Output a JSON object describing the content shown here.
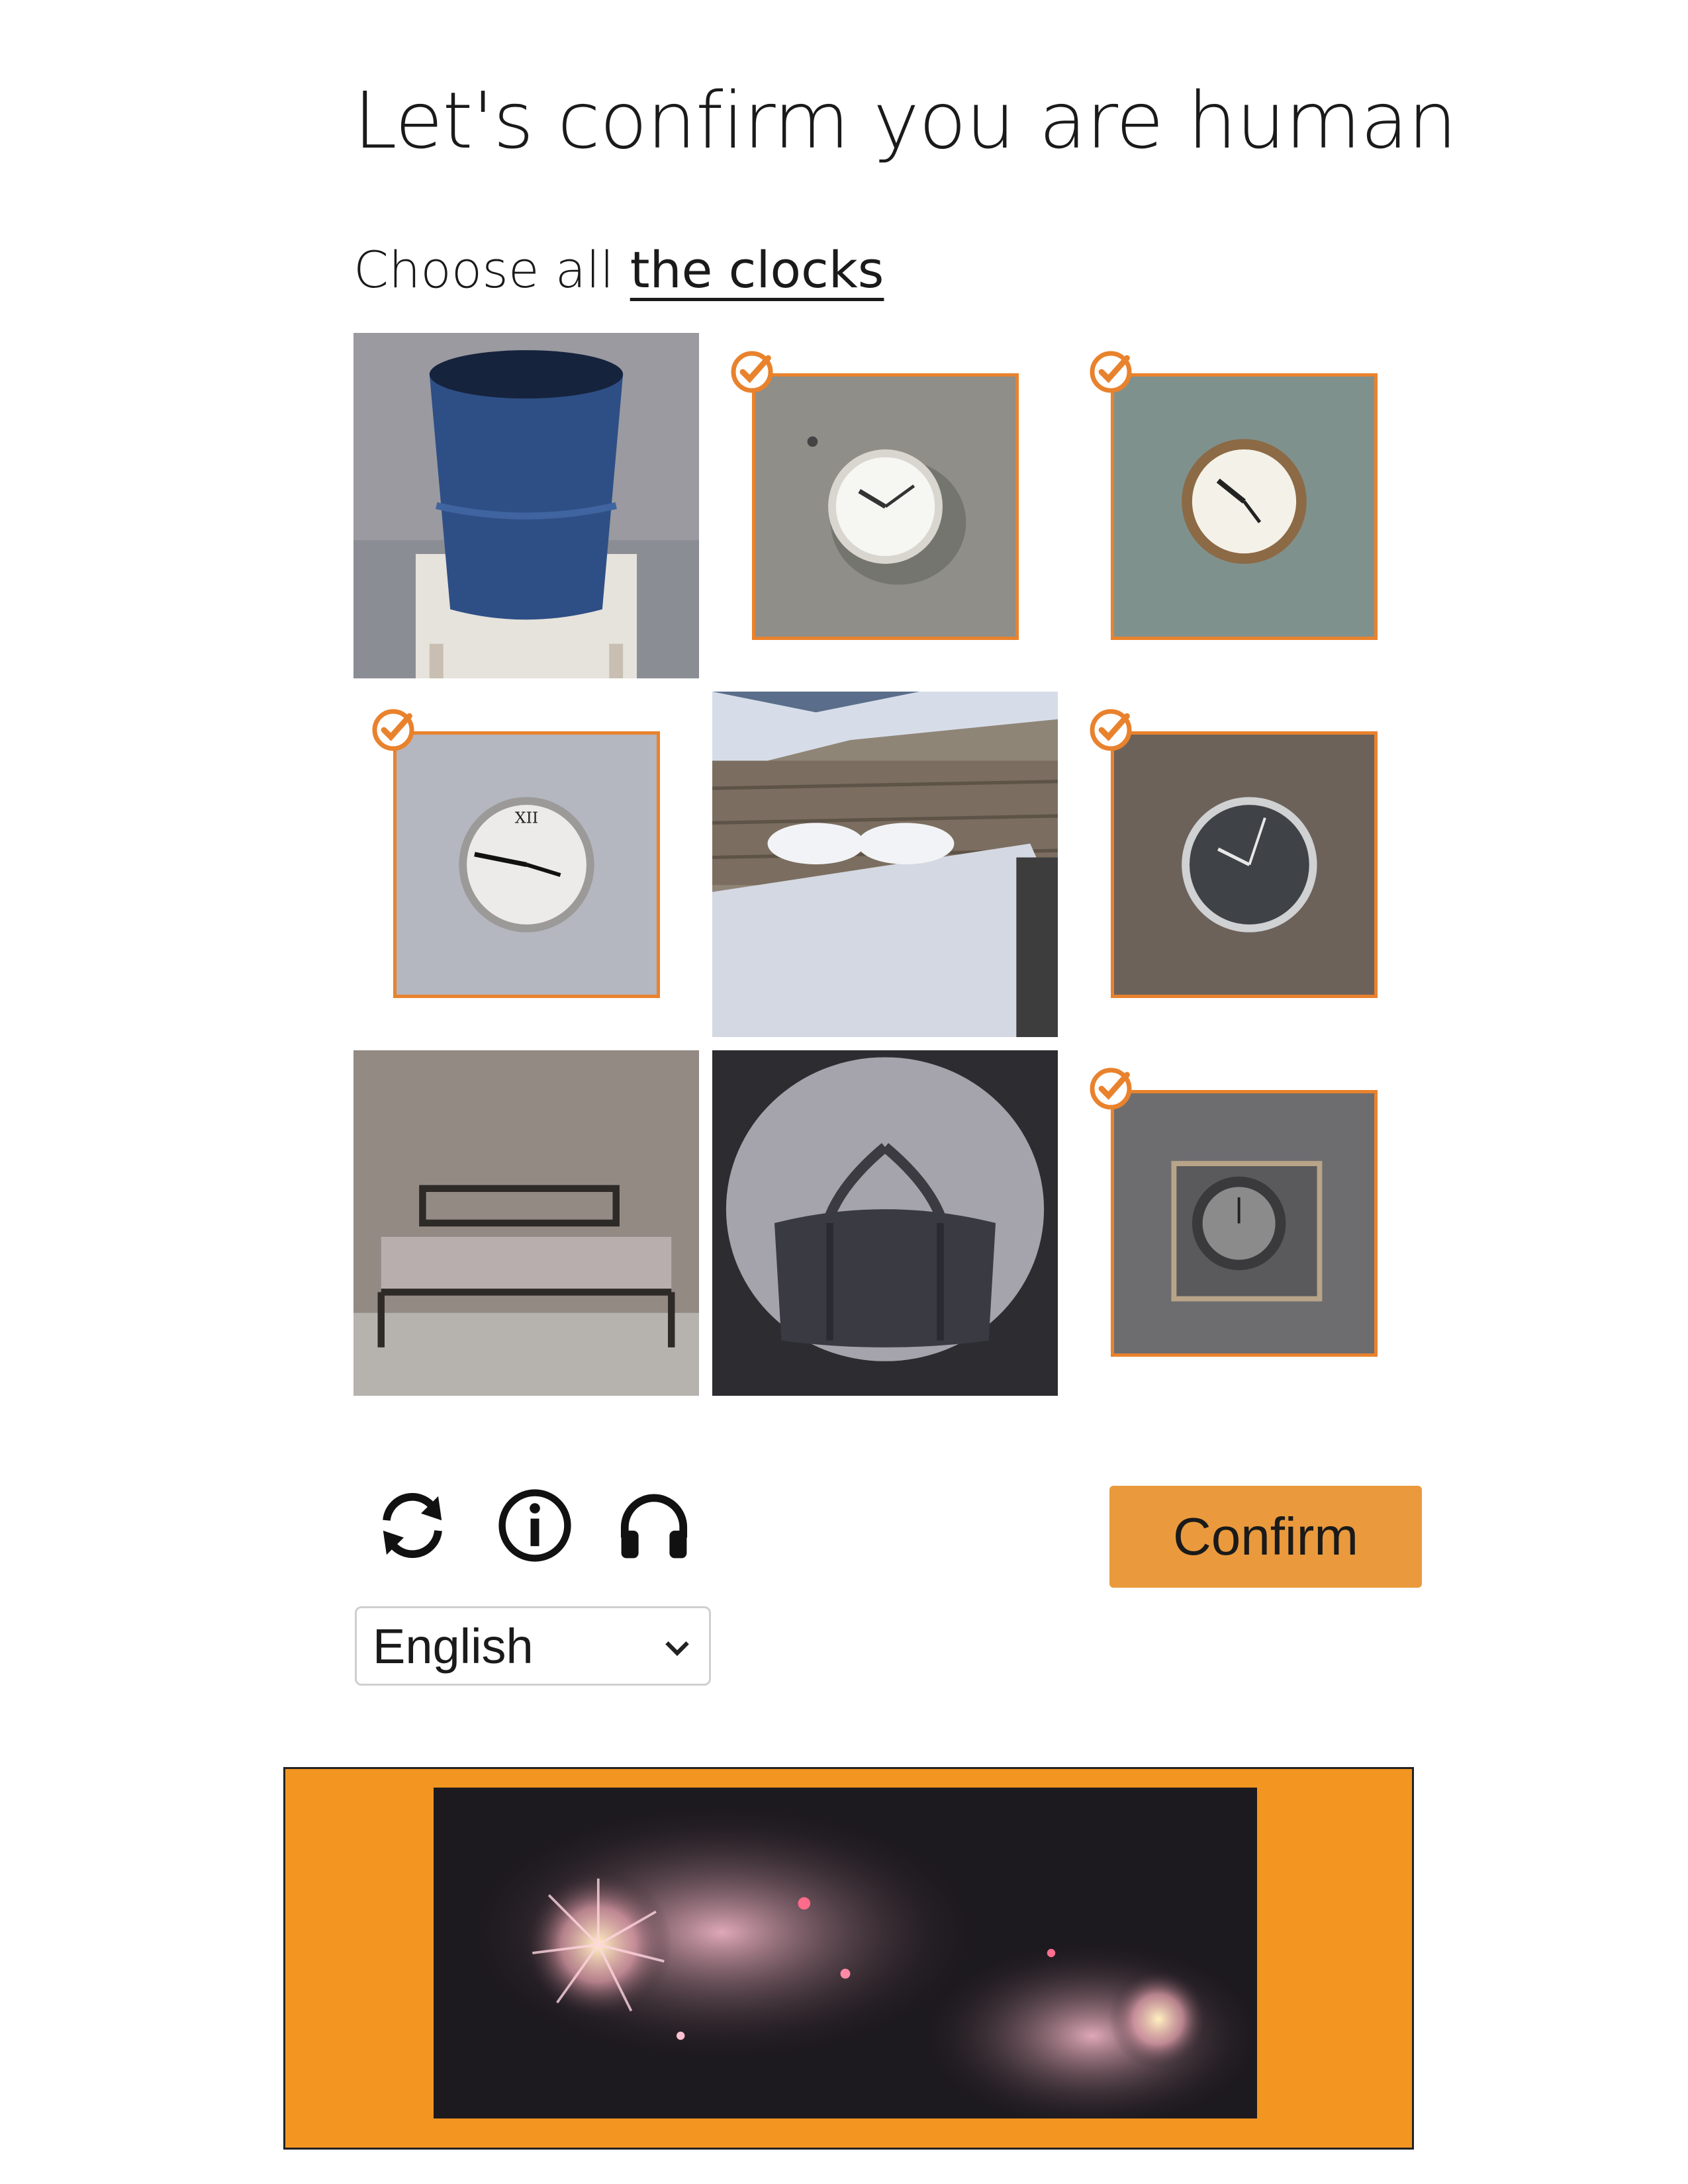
{
  "header": {
    "title": "Let's confirm you are human"
  },
  "instruction": {
    "prefix": "Choose all",
    "target": "the clocks"
  },
  "grid": {
    "tiles": [
      {
        "content": "blue bucket on stool",
        "selected": false
      },
      {
        "content": "white wall clock",
        "selected": true
      },
      {
        "content": "clock with gold rim",
        "selected": true
      },
      {
        "content": "clock with roman numerals",
        "selected": true
      },
      {
        "content": "bed in cabin",
        "selected": false
      },
      {
        "content": "dark face clock",
        "selected": true
      },
      {
        "content": "bed frame",
        "selected": false
      },
      {
        "content": "duffel bag",
        "selected": false
      },
      {
        "content": "square framed clock",
        "selected": true
      }
    ]
  },
  "controls": {
    "icons": [
      "refresh-icon",
      "info-icon",
      "headphones-icon"
    ],
    "confirm_label": "Confirm",
    "language": "English"
  },
  "banner": {
    "content": "fireworks",
    "background": "#f39521"
  },
  "colors": {
    "accent": "#e9822d",
    "button": "#ea9a3c"
  }
}
